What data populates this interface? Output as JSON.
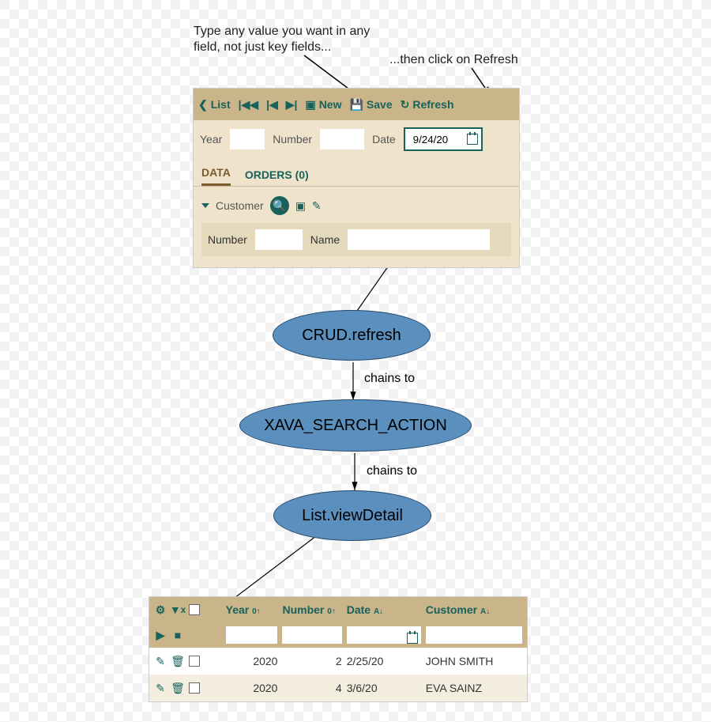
{
  "annotations": {
    "a1_line1": "Type any value you want in any",
    "a1_line2": "field, not just key fields...",
    "a2": "...then click on Refresh"
  },
  "toolbar": {
    "list": "List",
    "new": "New",
    "save": "Save",
    "refresh": "Refresh"
  },
  "form": {
    "year_label": "Year",
    "year_value": "",
    "number_label": "Number",
    "number_value": "",
    "date_label": "Date",
    "date_value": "9/24/20"
  },
  "tabs": {
    "data": "DATA",
    "orders": "ORDERS (0)"
  },
  "customer": {
    "title": "Customer",
    "number_label": "Number",
    "number_value": "",
    "name_label": "Name",
    "name_value": ""
  },
  "diagram": {
    "n1": "CRUD.refresh",
    "n2": "XAVA_SEARCH_ACTION",
    "n3": "List.viewDetail",
    "edge_label": "chains to"
  },
  "list": {
    "cols": {
      "year": "Year",
      "number": "Number",
      "date": "Date",
      "customer": "Customer"
    },
    "filters": {
      "year": "",
      "number": "",
      "date": "",
      "customer": ""
    },
    "rows": [
      {
        "year": "2020",
        "number": "2",
        "date": "2/25/20",
        "customer": "JOHN SMITH"
      },
      {
        "year": "2020",
        "number": "4",
        "date": "3/6/20",
        "customer": "EVA SAINZ"
      }
    ]
  },
  "chart_data": {
    "type": "flow",
    "nodes": [
      {
        "id": "n1",
        "label": "CRUD.refresh"
      },
      {
        "id": "n2",
        "label": "XAVA_SEARCH_ACTION"
      },
      {
        "id": "n3",
        "label": "List.viewDetail"
      }
    ],
    "edges": [
      {
        "from": "n1",
        "to": "n2",
        "label": "chains to"
      },
      {
        "from": "n2",
        "to": "n3",
        "label": "chains to"
      }
    ],
    "callouts": [
      {
        "text": "Type any value you want in any field, not just key fields...",
        "target": "Date input field"
      },
      {
        "text": "...then click on Refresh",
        "target": "Refresh toolbar button"
      }
    ]
  }
}
